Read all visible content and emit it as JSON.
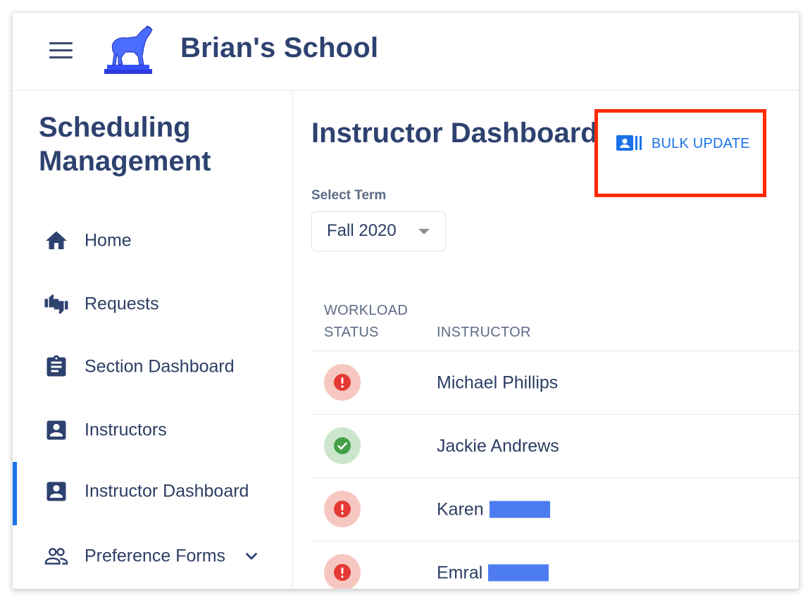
{
  "header": {
    "app_title": "Brian's School",
    "menu_icon": "menu-icon",
    "logo_icon": "greyhound-statue-logo"
  },
  "sidebar": {
    "title_line1": "Scheduling",
    "title_line2": "Management",
    "items": [
      {
        "label": "Home",
        "icon": "home-icon",
        "active": false
      },
      {
        "label": "Requests",
        "icon": "thumbs-up-down-icon",
        "active": false
      },
      {
        "label": "Section Dashboard",
        "icon": "clipboard-icon",
        "active": false
      },
      {
        "label": "Instructors",
        "icon": "person-box-icon",
        "active": false
      },
      {
        "label": "Instructor Dashboard",
        "icon": "person-box-icon",
        "active": true
      },
      {
        "label": "Preference Forms",
        "icon": "people-outline-icon",
        "active": false,
        "expandable": true
      }
    ]
  },
  "main": {
    "page_title": "Instructor Dashboard",
    "bulk_update_label": "BULK UPDATE",
    "term": {
      "label": "Select Term",
      "selected": "Fall 2020"
    },
    "table": {
      "headers": {
        "status_line1": "WORKLOAD",
        "status_line2": "STATUS",
        "instructor": "INSTRUCTOR"
      },
      "rows": [
        {
          "status": "warning",
          "name": "Michael Phillips",
          "redacted_surname": false
        },
        {
          "status": "ok",
          "name": "Jackie Andrews",
          "redacted_surname": false
        },
        {
          "status": "warning",
          "name": "Karen",
          "redacted_surname": true
        },
        {
          "status": "warning",
          "name": "Emral",
          "redacted_surname": true
        }
      ]
    }
  },
  "colors": {
    "accent": "#1a73e8",
    "heading": "#2e4270",
    "text": "#2c3e64",
    "warning": "#e53935",
    "warning_bg": "#f6c7c0",
    "ok": "#43a047",
    "ok_bg": "#cbe6cc",
    "highlight": "#ff2a00",
    "redaction": "#4c7cf0"
  }
}
